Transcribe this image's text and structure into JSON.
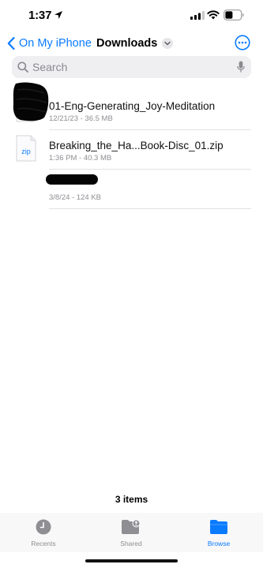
{
  "status_bar": {
    "time": "1:37"
  },
  "nav": {
    "back_label": "On My iPhone",
    "title": "Downloads"
  },
  "search": {
    "placeholder": "Search"
  },
  "files": [
    {
      "name": "01-Eng-Generating_Joy-Meditation",
      "meta": "12/21/23 - 36.5 MB",
      "icon": "audio-file-icon"
    },
    {
      "name": "Breaking_the_Ha...Book-Disc_01.zip",
      "meta": "1:36 PM - 40.3 MB",
      "icon": "zip-file-icon",
      "icon_text": "zip"
    },
    {
      "name": "",
      "meta": "3/8/24 - 124 KB",
      "icon": "redacted-file-icon"
    }
  ],
  "footer": {
    "count": "3 items"
  },
  "tabs": [
    {
      "label": "Recents",
      "icon": "clock-icon"
    },
    {
      "label": "Shared",
      "icon": "shared-folder-icon"
    },
    {
      "label": "Browse",
      "icon": "folder-icon"
    }
  ],
  "colors": {
    "accent": "#0a7bff",
    "secondary_text": "#8e8e93"
  }
}
